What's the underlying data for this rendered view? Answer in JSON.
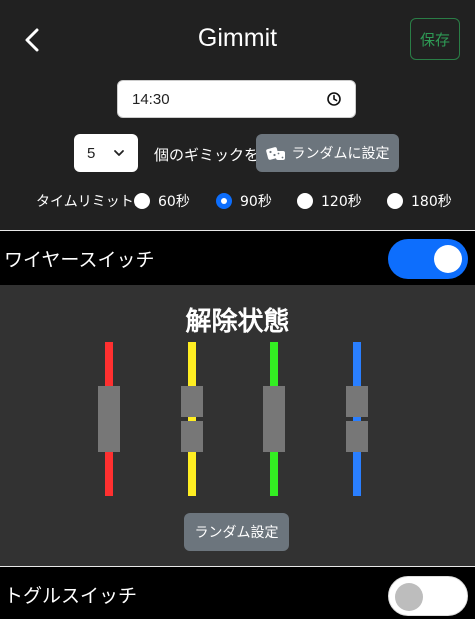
{
  "header": {
    "title": "Gimmit",
    "save_label": "保存"
  },
  "time_input": {
    "value": "14:30"
  },
  "gimmick_count": {
    "selected": "5",
    "suffix": "個のギミックを"
  },
  "random_setting_button": {
    "label": "ランダムに設定",
    "icon": "dice-icon"
  },
  "time_limit": {
    "label": "タイムリミット:",
    "options": [
      {
        "label": "60秒",
        "checked": false
      },
      {
        "label": "90秒",
        "checked": true
      },
      {
        "label": "120秒",
        "checked": false
      },
      {
        "label": "180秒",
        "checked": false
      }
    ]
  },
  "wire_switch": {
    "label": "ワイヤースイッチ",
    "enabled": true
  },
  "wire_panel": {
    "state_title": "解除状態",
    "random_button_label": "ランダム設定",
    "wires": [
      {
        "color": "#ff3030",
        "state": "connected"
      },
      {
        "color": "#ffee22",
        "state": "split"
      },
      {
        "color": "#33ee22",
        "state": "connected"
      },
      {
        "color": "#2a7fff",
        "state": "split"
      }
    ]
  },
  "toggle_switch": {
    "label": "トグルスイッチ",
    "enabled": false
  },
  "colors": {
    "accent": "#0d6efd",
    "save_green": "#2e9a55",
    "secondary_button": "#6c757d",
    "header_bg": "#212121",
    "panel_bg": "#323232"
  }
}
